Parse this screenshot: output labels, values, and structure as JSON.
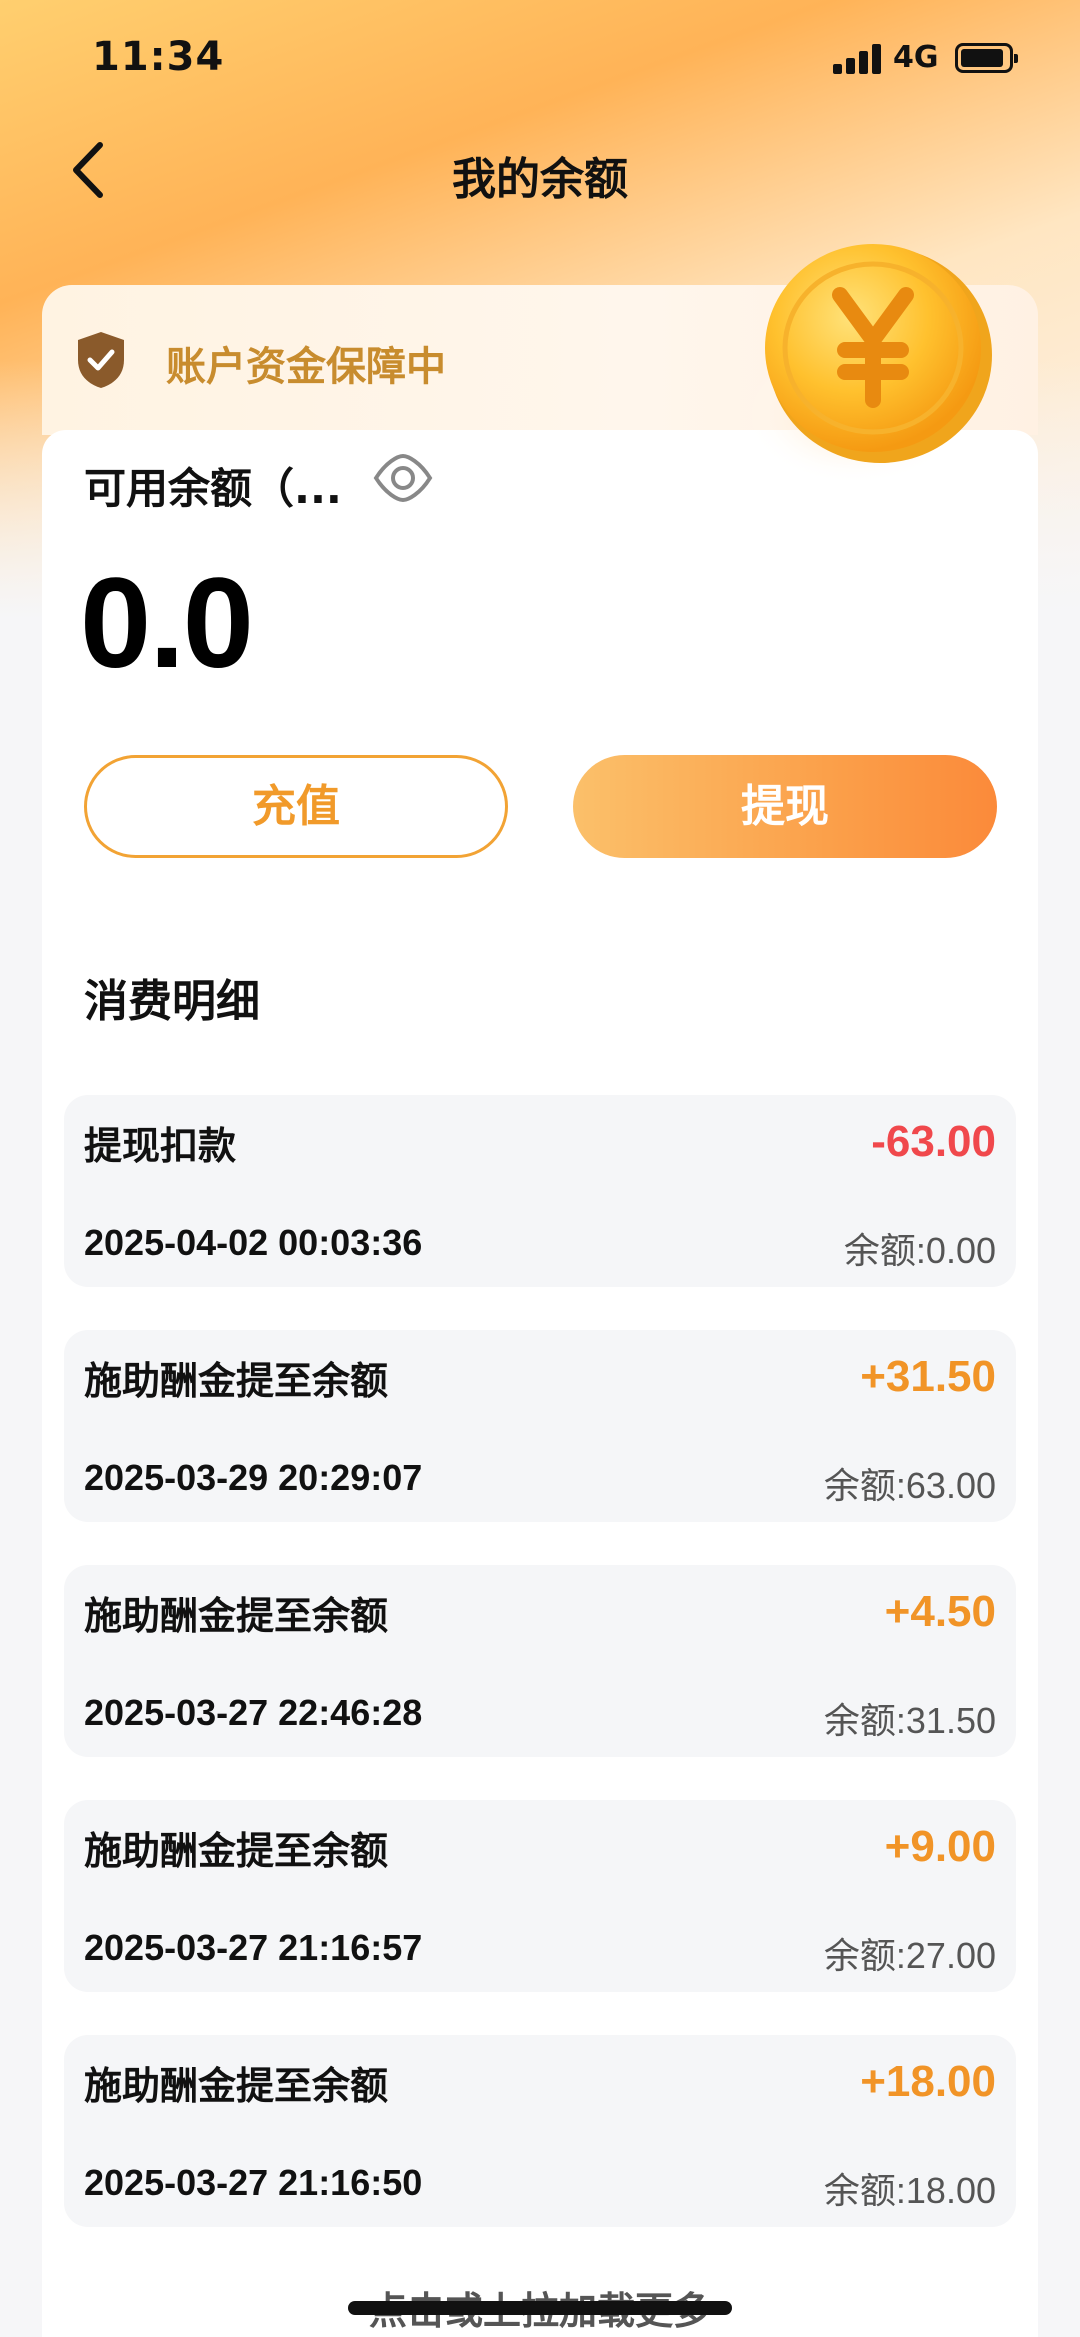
{
  "status_bar": {
    "time": "11:34",
    "network": "4G"
  },
  "nav": {
    "title": "我的余额"
  },
  "guard": {
    "text": "账户资金保障中"
  },
  "balance_card": {
    "label": "可用余额（...",
    "amount": "0.0",
    "recharge_label": "充值",
    "withdraw_label": "提现"
  },
  "details": {
    "title": "消费明细",
    "items": [
      {
        "title": "提现扣款",
        "amount": "-63.00",
        "time": "2025-04-02 00:03:36",
        "balance": "余额:0.00"
      },
      {
        "title": "施助酬金提至余额",
        "amount": "+31.50",
        "time": "2025-03-29 20:29:07",
        "balance": "余额:63.00"
      },
      {
        "title": "施助酬金提至余额",
        "amount": "+4.50",
        "time": "2025-03-27 22:46:28",
        "balance": "余额:31.50"
      },
      {
        "title": "施助酬金提至余额",
        "amount": "+9.00",
        "time": "2025-03-27 21:16:57",
        "balance": "余额:27.00"
      },
      {
        "title": "施助酬金提至余额",
        "amount": "+18.00",
        "time": "2025-03-27 21:16:50",
        "balance": "余额:18.00"
      }
    ]
  },
  "load_more": "点击或上拉加载更多",
  "colors": {
    "accent": "#f19427",
    "negative": "#f0484c",
    "guard_text": "#c88c2e"
  },
  "icons": [
    "back-arrow-icon",
    "shield-check-icon",
    "yuan-coin-icon",
    "eye-icon",
    "signal-icon",
    "battery-icon"
  ]
}
